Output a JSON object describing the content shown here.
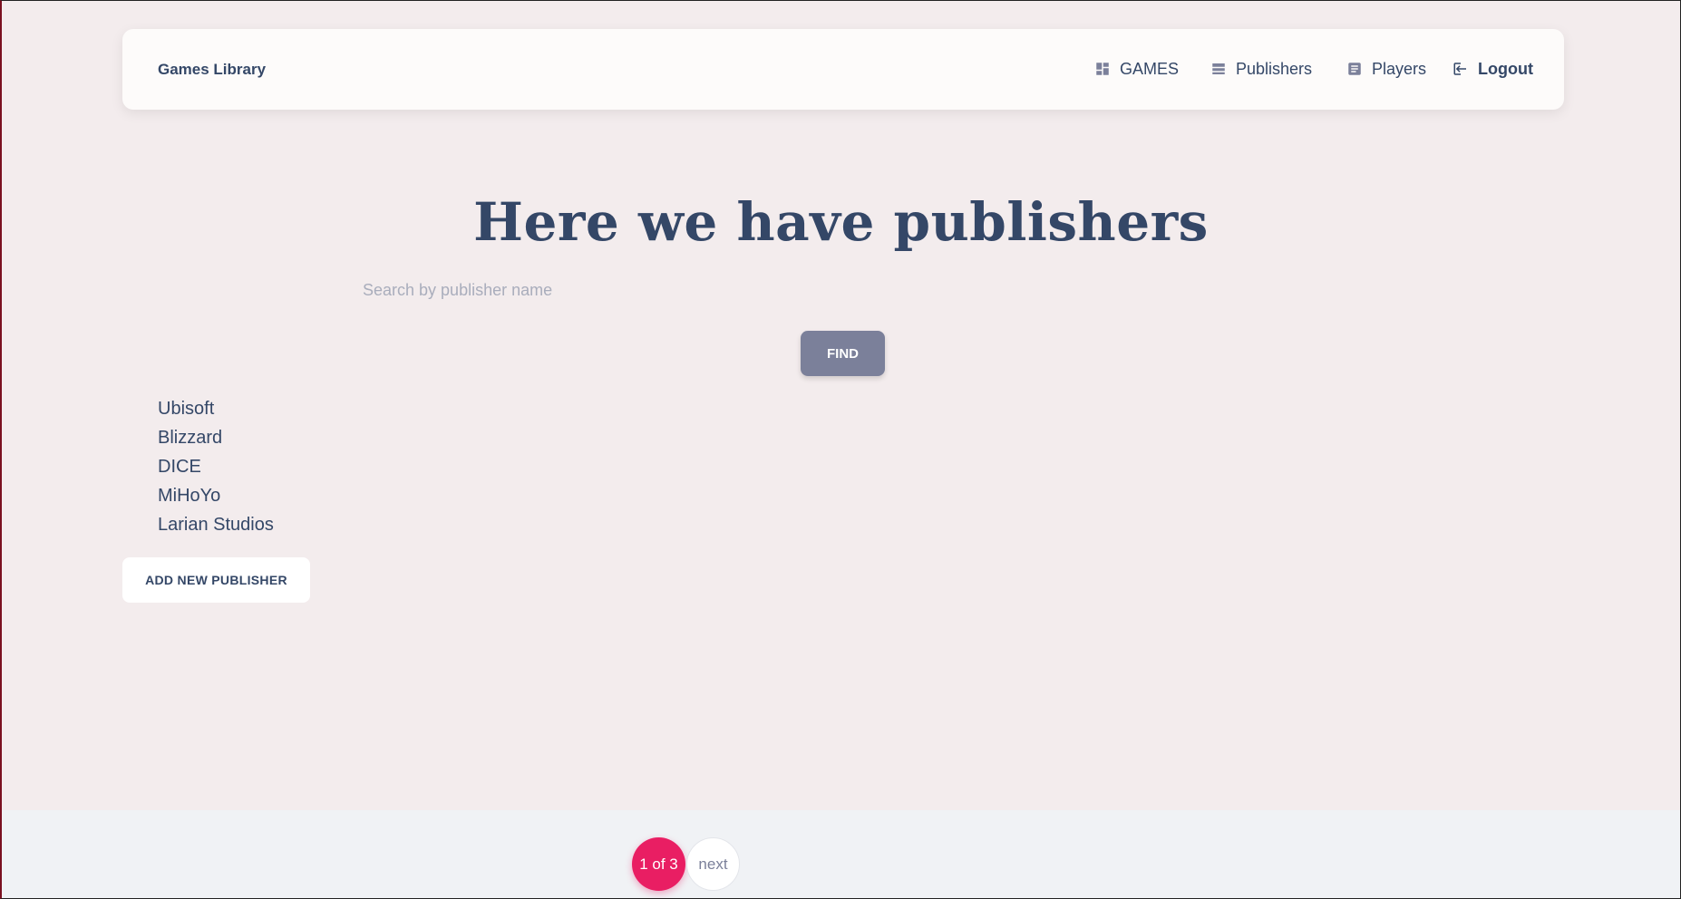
{
  "navbar": {
    "brand": "Games Library",
    "items": [
      {
        "label": "GAMES",
        "icon": "dashboard-icon"
      },
      {
        "label": "Publishers",
        "icon": "table-rows-icon"
      },
      {
        "label": "Players",
        "icon": "receipt-icon"
      },
      {
        "label": "Logout",
        "icon": "logout-icon"
      }
    ]
  },
  "main": {
    "title": "Here we have publishers",
    "search_placeholder": "Search by publisher name",
    "search_value": "",
    "find_label": "FIND",
    "publishers": [
      "Ubisoft",
      "Blizzard",
      "DICE",
      "MiHoYo",
      "Larian Studios"
    ],
    "add_label": "ADD NEW PUBLISHER"
  },
  "pagination": {
    "current": "1 of 3",
    "next_label": "next"
  },
  "colors": {
    "background": "#f3eced",
    "text": "#344767",
    "find_button": "#7b809a",
    "active_page": "#e91e63",
    "footer": "#f0f2f5"
  }
}
